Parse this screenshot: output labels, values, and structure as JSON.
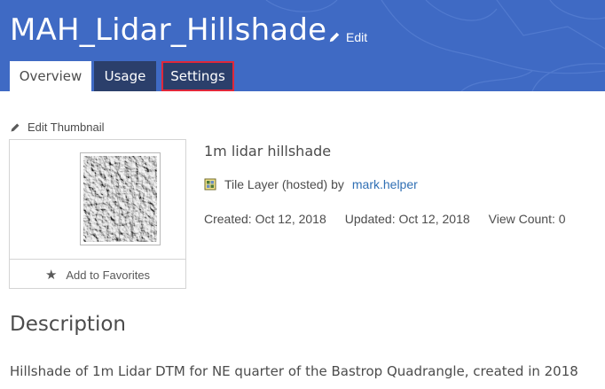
{
  "header": {
    "title": "MAH_Lidar_Hillshade",
    "edit_label": "Edit",
    "background_color": "#3f6ac4"
  },
  "tabs": [
    {
      "label": "Overview",
      "state": "active"
    },
    {
      "label": "Usage",
      "state": "inactive"
    },
    {
      "label": "Settings",
      "state": "highlighted"
    }
  ],
  "thumbnail": {
    "edit_label": "Edit Thumbnail",
    "favorite_label": "Add to Favorites",
    "favorite_icon": "star-icon"
  },
  "item": {
    "snippet": "1m lidar hillshade",
    "type_icon": "tile-layer-icon",
    "type_text": "Tile Layer (hosted) by",
    "owner": "mark.helper",
    "owner_color": "#2f6fb4",
    "created": "Created: Oct 12, 2018",
    "updated": "Updated: Oct 12, 2018",
    "view_count": "View Count: 0"
  },
  "description": {
    "heading": "Description",
    "text": "Hillshade of 1m Lidar DTM for NE quarter of the Bastrop Quadrangle, created in 2018"
  }
}
